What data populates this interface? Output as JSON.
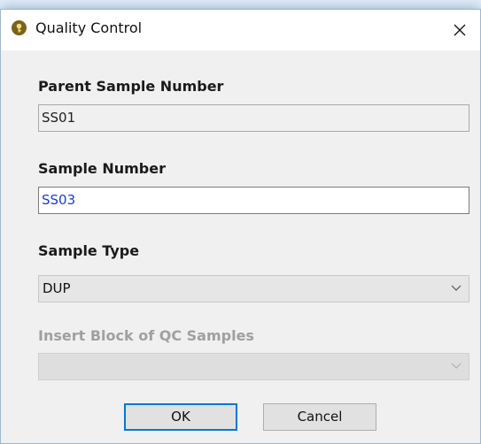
{
  "window": {
    "title": "Quality Control"
  },
  "form": {
    "parent_sample_number": {
      "label": "Parent Sample Number",
      "value": "SS01"
    },
    "sample_number": {
      "label": "Sample Number",
      "value": "SS03"
    },
    "sample_type": {
      "label": "Sample Type",
      "selected": "DUP"
    },
    "insert_block": {
      "label": "Insert Block of QC Samples",
      "selected": ""
    }
  },
  "buttons": {
    "ok": "OK",
    "cancel": "Cancel"
  },
  "icons": {
    "app": "key-icon",
    "close": "close-icon",
    "dropdown": "chevron-down-icon"
  },
  "colors": {
    "default_button_border": "#0078d7",
    "editable_text": "#1a3ccc",
    "disabled_label": "#a0a0a0"
  }
}
